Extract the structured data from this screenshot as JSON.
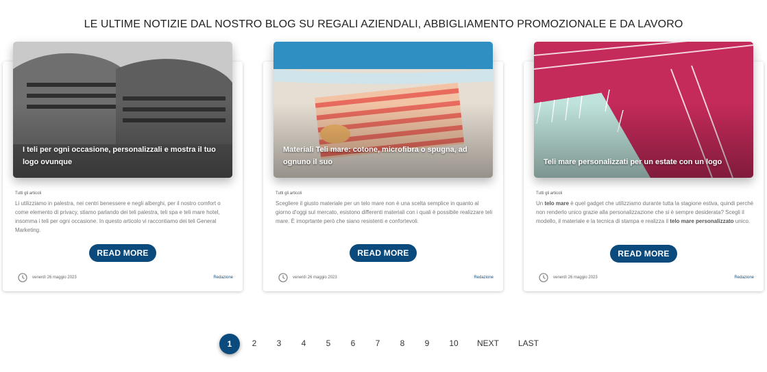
{
  "section_title": "LE ULTIME NOTIZIE DAL NOSTRO BLOG SU REGALI AZIENDALI, ABBIGLIAMENTO PROMOZIONALE E DA LAVORO",
  "posts": [
    {
      "title": "I teli per ogni occasione, personalizzali e mostra il tuo logo ovunque",
      "category": "Tutti gli articoli",
      "excerpt": "Li utilizziamo in palestra, nei centri benessere e negli alberghi, per il nostro comfort o come elemento di privacy, stiamo parlando dei teli palestra, teli spa e teli mare hotel, insomma i teli per ogni occasione. In questo articolo vi raccontiamo dei teli General Marketing.",
      "read_more": "READ MORE",
      "date": "venerdì 26 maggio 2023",
      "author": "Redazione"
    },
    {
      "title": "Materiali Teli mare: cotone, microfibra o spugna, ad ognuno il suo",
      "category": "Tutti gli articoli",
      "excerpt": "Scegliere il giusto materiale per un telo mare non è una scelta semplice in quanto al giorno d'oggi sul mercato, esistono differenti materiali con i quali è possibile realizzare teli mare. È imoprtante però che siano resistenti e confortevoli.",
      "read_more": "READ MORE",
      "date": "venerdì 26 maggio 2023",
      "author": "Redazione"
    },
    {
      "title": "Teli mare personalizzati per un estate con un logo",
      "category": "Tutti gli articoli",
      "excerpt_parts": [
        "Un ",
        "telo mare",
        " è quel gadget che utilizziamo durante tutta la stagione estiva, quindi perché non renderlo unico grazie alla personalizzazione che si è sempre desiderata? Scegli il modello, il materiale e la tecnica di stampa e realizza il ",
        "telo mare personalizzato",
        " unico."
      ],
      "read_more": "READ MORE",
      "date": "venerdì 26 maggio 2023",
      "author": "Redazione"
    }
  ],
  "pagination": {
    "current": "1",
    "pages": [
      "2",
      "3",
      "4",
      "5",
      "6",
      "7",
      "8",
      "9",
      "10"
    ],
    "next": "NEXT",
    "last": "LAST"
  },
  "colors": {
    "accent": "#0b4a7c",
    "author_link": "#1d4f7a"
  },
  "icons": {
    "meta": "clock-icon"
  }
}
